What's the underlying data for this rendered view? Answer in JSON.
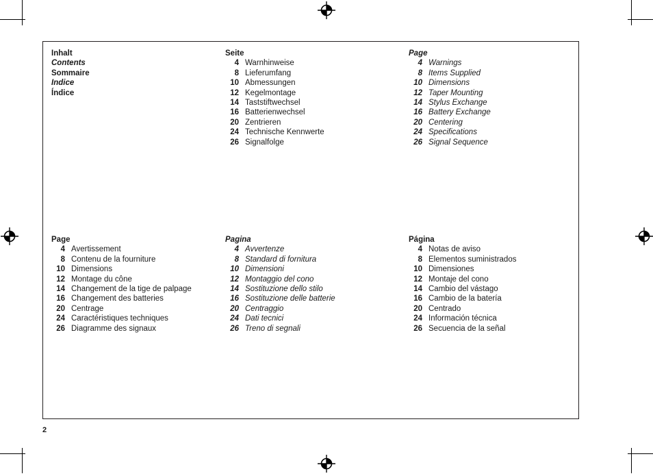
{
  "document": {
    "page_number": "2"
  },
  "index_heading": {
    "labels": [
      {
        "text": "Inhalt",
        "style": "bold"
      },
      {
        "text": "Contents",
        "style": "bold-italic"
      },
      {
        "text": "Sommaire",
        "style": "bold"
      },
      {
        "text": "Indice",
        "style": "bold-italic"
      },
      {
        "text": "Índice",
        "style": "bold"
      }
    ]
  },
  "columns": [
    {
      "id": "german",
      "title": "Seite",
      "style": "upright",
      "entries": [
        {
          "page": "4",
          "label": "Warnhinweise"
        },
        {
          "page": "8",
          "label": "Lieferumfang"
        },
        {
          "page": "10",
          "label": "Abmessungen"
        },
        {
          "page": "12",
          "label": "Kegelmontage"
        },
        {
          "page": "14",
          "label": "Taststiftwechsel"
        },
        {
          "page": "16",
          "label": "Batterienwechsel"
        },
        {
          "page": "20",
          "label": "Zentrieren"
        },
        {
          "page": "24",
          "label": "Technische Kennwerte"
        },
        {
          "page": "26",
          "label": "Signalfolge"
        }
      ]
    },
    {
      "id": "english",
      "title": "Page",
      "style": "italic",
      "entries": [
        {
          "page": "4",
          "label": "Warnings"
        },
        {
          "page": "8",
          "label": "Items Supplied"
        },
        {
          "page": "10",
          "label": "Dimensions"
        },
        {
          "page": "12",
          "label": "Taper Mounting"
        },
        {
          "page": "14",
          "label": "Stylus Exchange"
        },
        {
          "page": "16",
          "label": "Battery Exchange"
        },
        {
          "page": "20",
          "label": "Centering"
        },
        {
          "page": "24",
          "label": "Specifications"
        },
        {
          "page": "26",
          "label": "Signal Sequence"
        }
      ]
    },
    {
      "id": "french",
      "title": "Page",
      "style": "upright",
      "entries": [
        {
          "page": "4",
          "label": "Avertissement"
        },
        {
          "page": "8",
          "label": "Contenu de la fourniture"
        },
        {
          "page": "10",
          "label": "Dimensions"
        },
        {
          "page": "12",
          "label": "Montage du cône"
        },
        {
          "page": "14",
          "label": "Changement de la tige de palpage"
        },
        {
          "page": "16",
          "label": "Changement des batteries"
        },
        {
          "page": "20",
          "label": "Centrage"
        },
        {
          "page": "24",
          "label": "Caractéristiques techniques"
        },
        {
          "page": "26",
          "label": "Diagramme des signaux"
        }
      ]
    },
    {
      "id": "italian",
      "title": "Pagina",
      "style": "italic",
      "entries": [
        {
          "page": "4",
          "label": "Avvertenze"
        },
        {
          "page": "8",
          "label": "Standard di fornitura"
        },
        {
          "page": "10",
          "label": "Dimensioni"
        },
        {
          "page": "12",
          "label": "Montaggio del cono"
        },
        {
          "page": "14",
          "label": "Sostituzione dello stilo"
        },
        {
          "page": "16",
          "label": "Sostituzione delle batterie"
        },
        {
          "page": "20",
          "label": "Centraggio"
        },
        {
          "page": "24",
          "label": "Dati tecnici"
        },
        {
          "page": "26",
          "label": "Treno di segnali"
        }
      ]
    },
    {
      "id": "spanish",
      "title": "Página",
      "style": "upright",
      "entries": [
        {
          "page": "4",
          "label": "Notas de aviso"
        },
        {
          "page": "8",
          "label": "Elementos suministrados"
        },
        {
          "page": "10",
          "label": "Dimensiones"
        },
        {
          "page": "12",
          "label": "Montaje del cono"
        },
        {
          "page": "14",
          "label": "Cambio del vástago"
        },
        {
          "page": "16",
          "label": "Cambio de la batería"
        },
        {
          "page": "20",
          "label": "Centrado"
        },
        {
          "page": "24",
          "label": "Información técnica"
        },
        {
          "page": "26",
          "label": "Secuencia de la señal"
        }
      ]
    }
  ],
  "print_marks": {
    "registration_icon": "registration-target-icon",
    "crop_mark_icon": "crop-mark-icon",
    "accent_color": "#231f20"
  }
}
